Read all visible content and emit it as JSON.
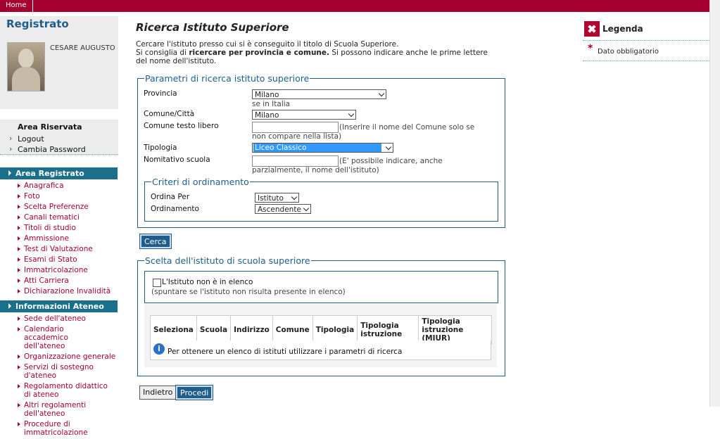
{
  "topbar": {
    "home": "Home"
  },
  "user": {
    "title": "Registrato",
    "name": "CESARE AUGUSTO"
  },
  "area_riservata": {
    "heading": "Area Riservata",
    "items": [
      "Logout",
      "Cambia Password"
    ]
  },
  "nav": {
    "section1": {
      "title": "Area Registrato",
      "items": [
        "Anagrafica",
        "Foto",
        "Scelta Preferenze",
        "Canali tematici",
        "Titoli di studio",
        "Ammissione",
        "Test di Valutazione",
        "Esami di Stato",
        "Immatricolazione",
        "Atti Carriera",
        "Dichiarazione Invalidità"
      ]
    },
    "section2": {
      "title": "Informazioni Ateneo",
      "items": [
        "Sede dell'ateneo",
        "Calendario accademico dell'ateneo",
        "Organizzazione generale",
        "Servizi di sostegno d'ateneo",
        "Regolamento didattico di ateneo",
        "Altri regolamenti dell'ateneo",
        "Procedure di immatricolazione"
      ]
    }
  },
  "page": {
    "title": "Ricerca Istituto Superiore",
    "intro_line1": "Cercare l'istituto presso cui si è conseguito il titolo di Scuola Superiore.",
    "intro_line2_pre": "Si consiglia di ",
    "intro_line2_bold": "ricercare per provincia e comune.",
    "intro_line2_post": " Si possono indicare anche le prime lettere del nome dell'istituto."
  },
  "search": {
    "legend": "Parametri di ricerca istituto superiore",
    "provincia_label": "Provincia",
    "provincia_value": "Milano",
    "provincia_hint": "se in Italia",
    "comune_label": "Comune/Città",
    "comune_value": "Milano",
    "comune_libero_label": "Comune testo libero",
    "comune_libero_hint": "(Inserire il nome del Comune solo se non compare nella lista)",
    "tipologia_label": "Tipologia",
    "tipologia_value": "Liceo Classico",
    "nominativo_label": "Nomitativo scuola",
    "nominativo_hint": "(E' possibile indicare, anche parzialmente, il nome dell'istituto)",
    "criteri_legend": "Criteri di ordinamento",
    "ordina_label": "Ordina Per",
    "ordina_value": "Istituto",
    "ordinamento_label": "Ordinamento",
    "ordinamento_value": "Ascendente",
    "cerca": "Cerca"
  },
  "scelta": {
    "legend": "Scelta dell'istituto di scuola superiore",
    "checkbox_label": "L'Istituto non è in elenco",
    "checkbox_hint": "(spuntare se l'istituto non risulta presente in elenco)",
    "columns": [
      "Seleziona",
      "Scuola",
      "Indirizzo",
      "Comune",
      "Tipologia",
      "Tipologia istruzione",
      "Tipologia istruzione (MIUR)"
    ],
    "info": "Per ottenere un elenco di istituti utilizzare i parametri di ricerca"
  },
  "buttons": {
    "indietro": "Indietro",
    "procedi": "Procedi"
  },
  "legenda": {
    "title": "Legenda",
    "required": "Dato obbligatorio"
  },
  "colors": {
    "brand": "#a5002f",
    "nav": "#1a6f8a",
    "accent": "#1f5d8c"
  }
}
